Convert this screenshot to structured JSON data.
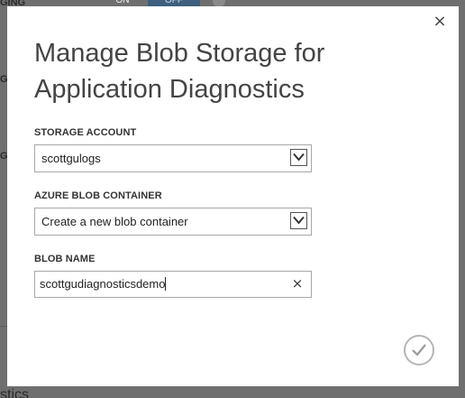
{
  "background": {
    "frag_top_left": "GING",
    "toggle_on": "ON",
    "toggle_off": "OFF",
    "frag_mid1": "G",
    "frag_mid2": "G",
    "frag_bottom": "stics"
  },
  "dialog": {
    "close_label": "×",
    "title": "Manage Blob Storage for Application Diagnostics",
    "storage_account": {
      "label": "STORAGE ACCOUNT",
      "selected": "scottgulogs"
    },
    "blob_container": {
      "label": "AZURE BLOB CONTAINER",
      "selected": "Create a new blob container"
    },
    "blob_name": {
      "label": "BLOB NAME",
      "value": "scottgudiagnosticsdemo",
      "clear_label": "×"
    }
  },
  "icons": {
    "close": "close-icon",
    "dropdown": "chevron-down-icon",
    "clear": "clear-icon",
    "confirm": "checkmark-icon"
  },
  "colors": {
    "overlay": "#6f6f6f",
    "dialog_bg": "#ffffff",
    "toggle_active": "#3e5f7d"
  }
}
